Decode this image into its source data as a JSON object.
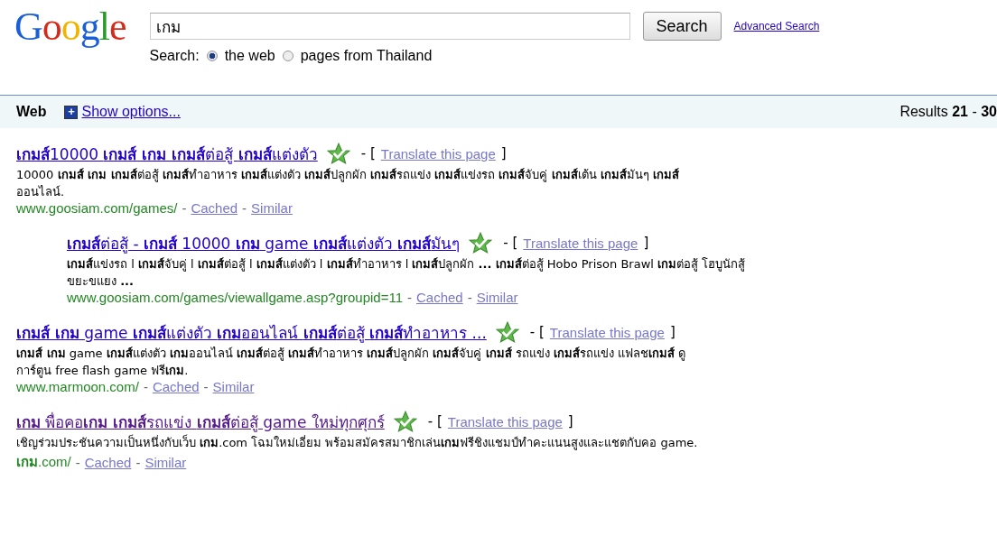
{
  "logo": "Google",
  "search": {
    "value": "เกม",
    "button": "Search",
    "advanced": "Advanced Search",
    "scope_label": "Search:",
    "scopes": [
      {
        "label": "the web",
        "selected": true
      },
      {
        "label": "pages from Thailand",
        "selected": false
      }
    ]
  },
  "punct": {
    "open": "- [",
    "close": "]",
    "dash": "-"
  },
  "bar": {
    "title": "Web",
    "options_icon": "+",
    "options": "Show options...",
    "results_prefix": "Results ",
    "results_from": "21",
    "results_sep": " - ",
    "results_to": "30"
  },
  "results": [
    {
      "title": "**เกมส์**10000 **เกมส์ เกม เกมส์**ต่อสู้ **เกมส์**แต่งตัว",
      "visited": false,
      "indented": false,
      "translate": "Translate this page",
      "snippet": "10000 **เกมส์ เกม เกมส์**ต่อสู้ **เกมส์**ทำอาหาร **เกมส์**แต่งตัว **เกมส์**ปลูกผัก **เกมส์**รถแข่ง **เกมส์**แข่งรถ **เกมส์**จับคู่ **เกมส์**เต้น **เกมส์**มันๆ **เกมส์**ออนไลน์.",
      "url": "www.goosiam.com/games/",
      "cached": "Cached",
      "similar": "Similar"
    },
    {
      "title": "**เกมส์**ต่อสู้ - **เกมส์** 10000 **เกม** game **เกมส์**แต่งตัว **เกมส์**มันๆ",
      "visited": false,
      "indented": true,
      "translate": "Translate this page",
      "snippet": "**เกมส์**แข่งรถ l **เกมส์**จับคู่ l **เกมส์**ต่อสู้ l **เกมส์**แต่งตัว l **เกมส์**ทำอาหาร l **เกมส์**ปลูกผัก **...** **เกมส์**ต่อสู้ Hobo Prison Brawl **เกม**ต่อสู้ โฮบูนักสู้ขยะขแยง **...**",
      "url": "www.goosiam.com/games/viewallgame.asp?groupid=11",
      "cached": "Cached",
      "similar": "Similar"
    },
    {
      "title": "**เกมส์ เกม** game **เกมส์**แต่งตัว **เกม**ออนไลน์ **เกมส์**ต่อสู้ **เกมส์**ทำอาหาร ...",
      "visited": false,
      "indented": false,
      "translate": "Translate this page",
      "snippet": "**เกมส์ เกม** game **เกมส์**แต่งตัว **เกม**ออนไลน์ **เกมส์**ต่อสู้ **เกมส์**ทำอาหาร **เกมส์**ปลูกผัก **เกมส์**จับคู่ **เกมส์** รถแข่ง **เกมส์**รถแข่ง แฟลช**เกมส์** ดูการ์ตูน free flash game ฟรี**เกม**.",
      "url": "www.marmoon.com/",
      "cached": "Cached",
      "similar": "Similar"
    },
    {
      "title": "**เกม** พื่อคอ**เกม เกมส์**รถแข่ง **เกมส์**ต่อสู้ game ใหม่ทุกศุกร์",
      "visited": true,
      "indented": false,
      "translate": "Translate this page",
      "snippet": "เชิญร่วมประชันความเป็นหนึ่งกับเว็บ **เกม**.com โฉมใหม่เอี่ยม พร้อมสมัครสมาชิกเล่น**เกม**ฟรีชิงแชมป์ทำคะแนนสูงและแชตกับคอ game.",
      "url": "**เกม**.com/",
      "cached": "Cached",
      "similar": "Similar"
    }
  ]
}
